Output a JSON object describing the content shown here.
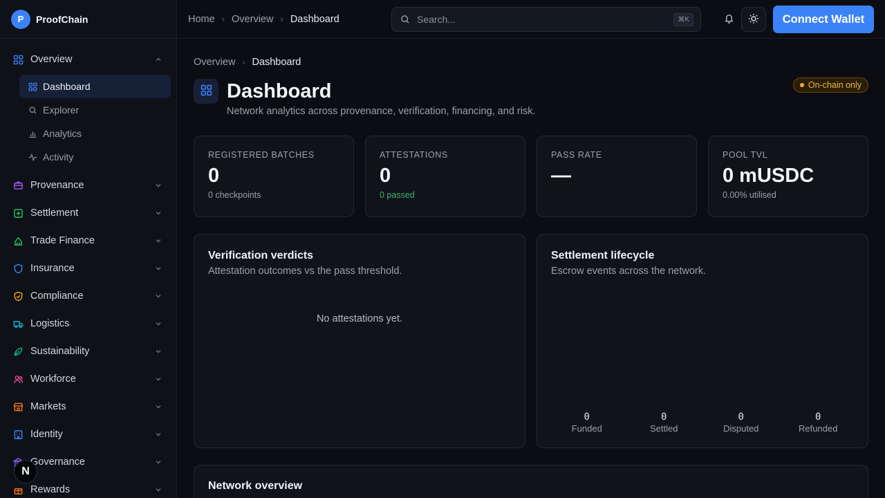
{
  "brand": {
    "logo_letter": "P",
    "name": "ProofChain"
  },
  "sidebar": {
    "groups": [
      {
        "label": "Overview",
        "icon": "grid-icon",
        "color": "#3b82f6",
        "expanded": true,
        "items": [
          {
            "label": "Dashboard",
            "icon": "grid-icon",
            "active": true
          },
          {
            "label": "Explorer",
            "icon": "search-icon"
          },
          {
            "label": "Analytics",
            "icon": "bar-chart-icon"
          },
          {
            "label": "Activity",
            "icon": "pulse-icon"
          }
        ]
      },
      {
        "label": "Provenance",
        "icon": "box-icon",
        "color": "#a855f7"
      },
      {
        "label": "Settlement",
        "icon": "plus-square-icon",
        "color": "#22c55e"
      },
      {
        "label": "Trade Finance",
        "icon": "landmark-icon",
        "color": "#22c55e"
      },
      {
        "label": "Insurance",
        "icon": "shield-icon",
        "color": "#3b82f6"
      },
      {
        "label": "Compliance",
        "icon": "shield-check-icon",
        "color": "#f59e0b"
      },
      {
        "label": "Logistics",
        "icon": "truck-icon",
        "color": "#06b6d4"
      },
      {
        "label": "Sustainability",
        "icon": "leaf-icon",
        "color": "#10b981"
      },
      {
        "label": "Workforce",
        "icon": "users-icon",
        "color": "#ec4899"
      },
      {
        "label": "Markets",
        "icon": "store-icon",
        "color": "#f97316"
      },
      {
        "label": "Identity",
        "icon": "building-icon",
        "color": "#3b82f6"
      },
      {
        "label": "Governance",
        "icon": "bank-icon",
        "color": "#8b5cf6"
      },
      {
        "label": "Rewards",
        "icon": "gift-icon",
        "color": "#f97316"
      }
    ],
    "nx_badge": "N"
  },
  "topbar": {
    "breadcrumb": [
      "Home",
      "Overview",
      "Dashboard"
    ],
    "search_placeholder": "Search...",
    "search_shortcut": "⌘K",
    "connect_wallet": "Connect Wallet"
  },
  "page": {
    "breadcrumb": [
      "Overview",
      "Dashboard"
    ],
    "title": "Dashboard",
    "subtitle": "Network analytics across provenance, verification, financing, and risk.",
    "pill": "On-chain only"
  },
  "stats": [
    {
      "label": "REGISTERED BATCHES",
      "value": "0",
      "sub": "0 checkpoints"
    },
    {
      "label": "ATTESTATIONS",
      "value": "0",
      "sub": "0 passed"
    },
    {
      "label": "PASS RATE",
      "value": "—",
      "sub": ""
    },
    {
      "label": "POOL TVL",
      "value": "0 mUSDC",
      "sub": "0.00% utilised"
    }
  ],
  "panels": {
    "verification": {
      "title": "Verification verdicts",
      "subtitle": "Attestation outcomes vs the pass threshold.",
      "empty": "No attestations yet."
    },
    "settlement": {
      "title": "Settlement lifecycle",
      "subtitle": "Escrow events across the network.",
      "stages": [
        {
          "label": "Funded",
          "value": "0"
        },
        {
          "label": "Settled",
          "value": "0"
        },
        {
          "label": "Disputed",
          "value": "0"
        },
        {
          "label": "Refunded",
          "value": "0"
        }
      ]
    },
    "network": {
      "title": "Network overview"
    }
  }
}
